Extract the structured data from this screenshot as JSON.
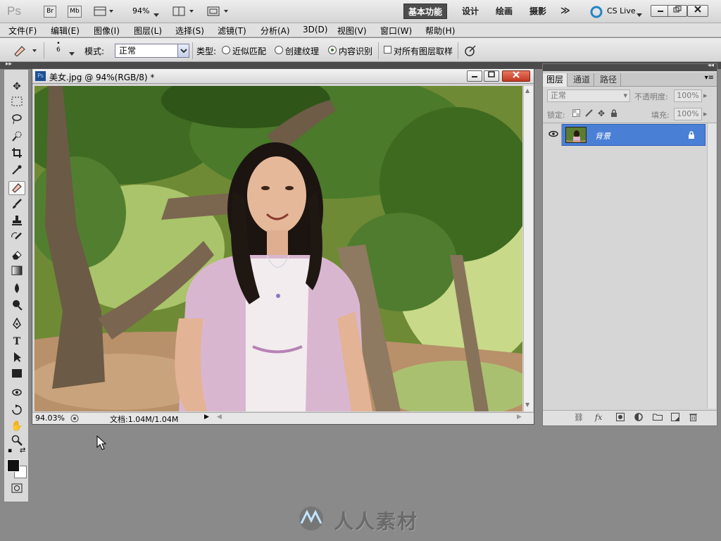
{
  "appbar": {
    "logo": "Ps",
    "br": "Br",
    "mb": "Mb",
    "zoom": "94%",
    "workspaces": [
      "基本功能",
      "设计",
      "绘画",
      "摄影"
    ],
    "more": "≫",
    "cslive": "CS Live"
  },
  "menu": [
    "文件(F)",
    "编辑(E)",
    "图像(I)",
    "图层(L)",
    "选择(S)",
    "滤镜(T)",
    "分析(A)",
    "3D(D)",
    "视图(V)",
    "窗口(W)",
    "帮助(H)"
  ],
  "options": {
    "brush_size": "6",
    "mode_label": "模式:",
    "mode_value": "正常",
    "type_label": "类型:",
    "type_options": [
      "近似匹配",
      "创建纹理",
      "内容识别"
    ],
    "selected_type": "内容识别",
    "sample_all_layers": "对所有图层取样",
    "sample_all_checked": false
  },
  "document": {
    "title": "美女.jpg @ 94%(RGB/8) *",
    "zoom_status": "94.03%",
    "doc_size": "文档:1.04M/1.04M"
  },
  "layers_panel": {
    "tabs": [
      "图层",
      "通道",
      "路径"
    ],
    "blend_mode": "正常",
    "opacity_label": "不透明度:",
    "opacity_value": "100%",
    "lock_label": "锁定:",
    "fill_label": "填充:",
    "fill_value": "100%",
    "layer_name": "背景"
  },
  "watermark": "人人素材",
  "colors": {
    "accent": "#4a7fd6",
    "workspace_active": "#4d4d4d"
  }
}
